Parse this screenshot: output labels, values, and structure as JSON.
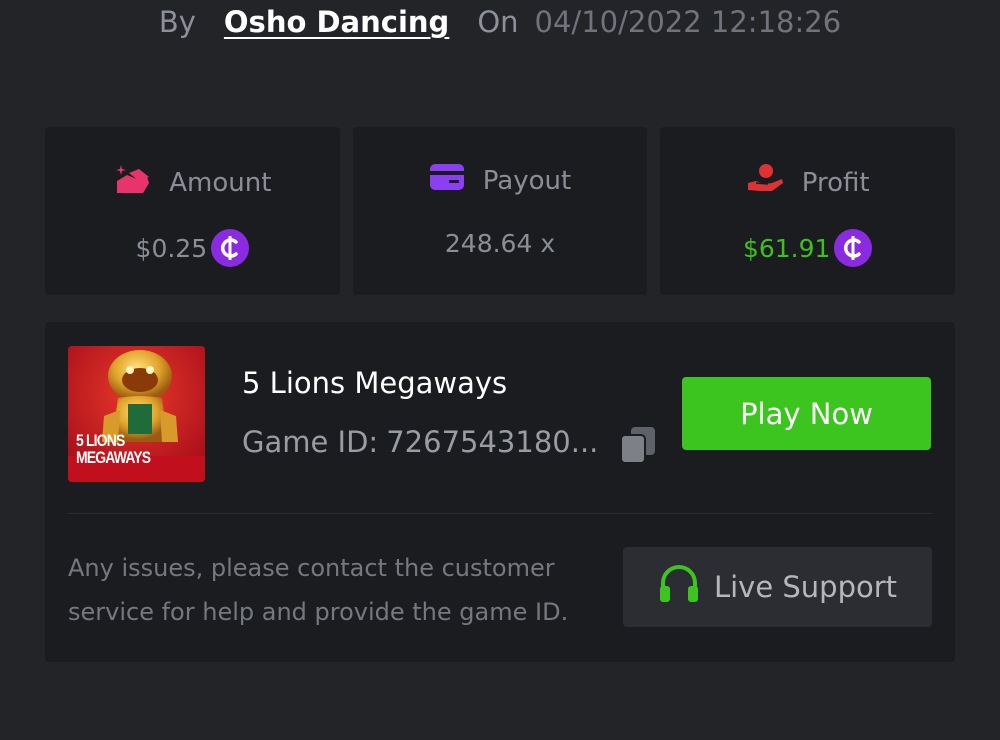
{
  "header": {
    "by_label": "By",
    "username": "Osho Dancing",
    "on_label": "On",
    "datetime": "04/10/2022 12:18:26"
  },
  "stats": {
    "amount": {
      "label": "Amount",
      "value": "$0.25",
      "icon": "amount-icon",
      "icon_color": "#e8336c"
    },
    "payout": {
      "label": "Payout",
      "value": "248.64 x",
      "icon": "card-icon",
      "icon_color": "#8a3ff0"
    },
    "profit": {
      "label": "Profit",
      "value": "$61.91",
      "icon": "hand-coin-icon",
      "icon_color": "#e03232",
      "value_color": "#3dc11e"
    }
  },
  "game": {
    "thumbnail_text_line1": "5 LIONS",
    "thumbnail_text_line2": "MEGAWAYS",
    "title": "5 Lions Megaways",
    "id_label": "Game ID:",
    "id_value": "7267543180...",
    "play_label": "Play Now"
  },
  "support": {
    "message": "Any issues, please contact the customer service for help and provide the game ID.",
    "button_label": "Live Support"
  },
  "colors": {
    "background": "#232428",
    "card": "#1b1c20",
    "accent_green": "#3cc51e",
    "coin_purple": "#8a2be2"
  }
}
